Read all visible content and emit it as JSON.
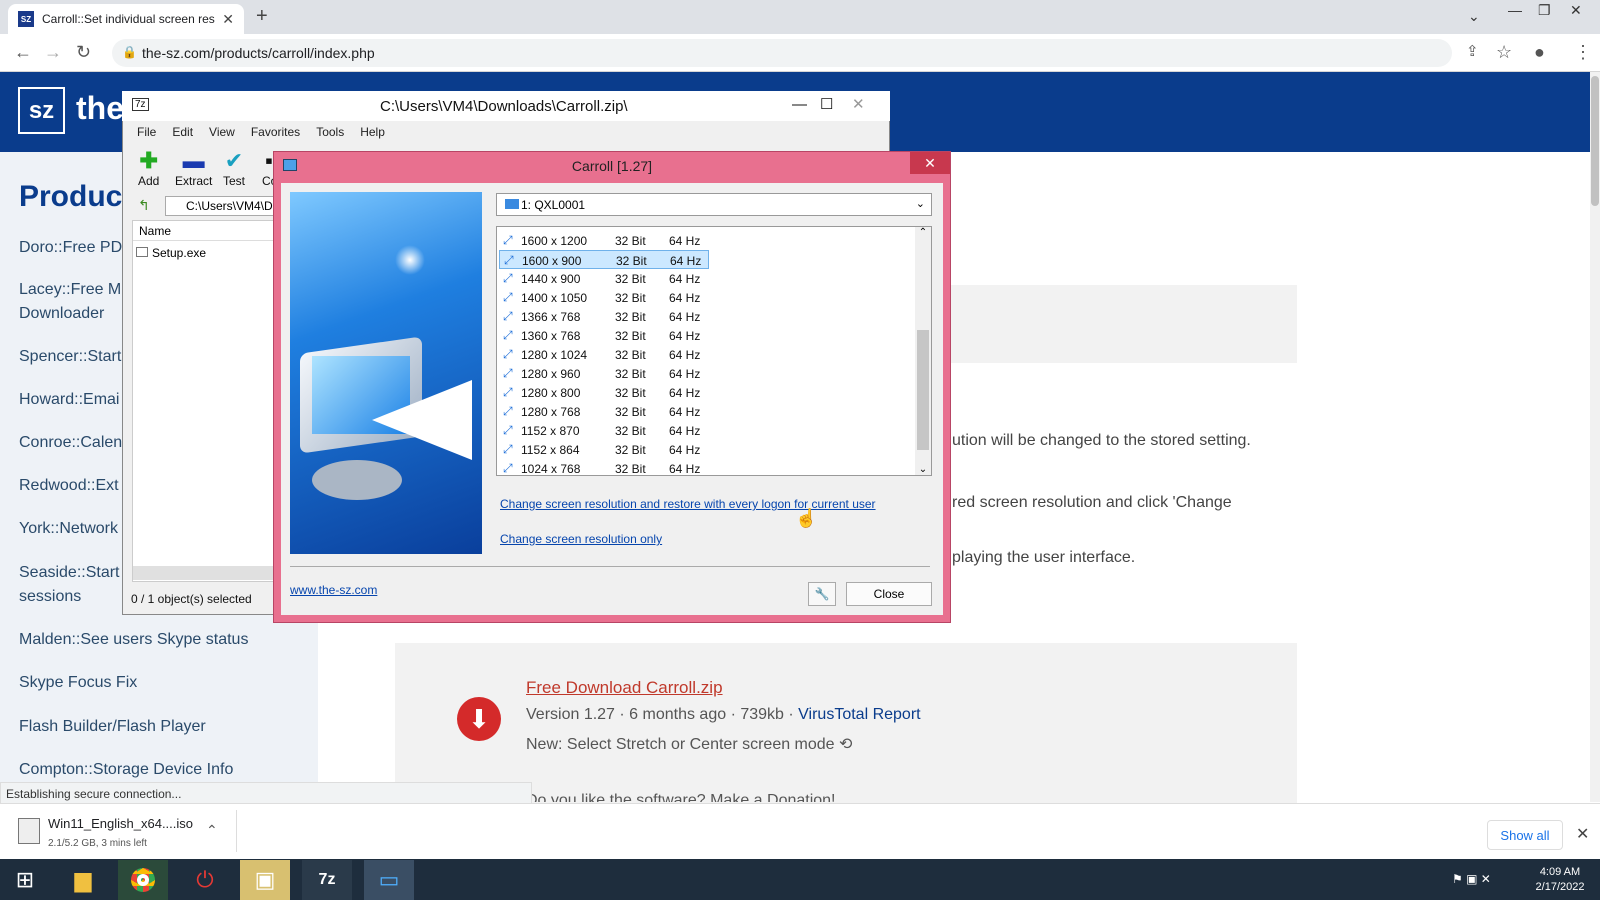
{
  "browser": {
    "tab_title": "Carroll::Set individual screen res…",
    "tab_favicon": "SZ",
    "url": "the-sz.com/products/carroll/index.php",
    "status": "Establishing secure connection..."
  },
  "page": {
    "logo": "sz",
    "logo_text": "the",
    "products_title": "Produc",
    "sidebar": [
      "Doro::Free PDI",
      "Lacey::Free Mu",
      "Downloader",
      "Spencer::Start",
      "Howard::Emai",
      "Conroe::Calen",
      "Redwood::Ext",
      "York::Network",
      "Seaside::Start",
      "sessions",
      "Malden::See users Skype status",
      "Skype Focus Fix",
      "Flash Builder/Flash Player",
      "Compton::Storage Device Info"
    ],
    "text1": "ution will be changed to the stored setting.",
    "text2": "red screen resolution and click 'Change",
    "text3": "playing the user interface.",
    "download_link": "Free Download Carroll.zip",
    "download_meta_prefix": "Version 1.27 · 6 months ago · 739kb · ",
    "download_meta_link": "VirusTotal Report",
    "download_new": "New: Select Stretch or Center screen mode ⟲",
    "donate": "Do you like the software? Make a Donation!"
  },
  "download_bar": {
    "file": "Win11_English_x64....iso",
    "progress": "2.1/5.2 GB, 3 mins left",
    "show_all": "Show all"
  },
  "taskbar": {
    "time": "4:09 AM",
    "date": "2/17/2022"
  },
  "zip": {
    "title": "C:\\Users\\VM4\\Downloads\\Carroll.zip\\",
    "menu": [
      "File",
      "Edit",
      "View",
      "Favorites",
      "Tools",
      "Help"
    ],
    "tools": [
      "Add",
      "Extract",
      "Test",
      "Co"
    ],
    "address": "C:\\Users\\VM4\\D",
    "col_name": "Name",
    "file": "Setup.exe",
    "status": "0 / 1 object(s) selected"
  },
  "carroll": {
    "title": "Carroll [1.27]",
    "display": "1: QXL0001",
    "resolutions": [
      {
        "res": "1600 x 1200",
        "bits": "32 Bit",
        "hz": "64 Hz"
      },
      {
        "res": "1600 x 900",
        "bits": "32 Bit",
        "hz": "64 Hz"
      },
      {
        "res": "1440 x 900",
        "bits": "32 Bit",
        "hz": "64 Hz"
      },
      {
        "res": "1400 x 1050",
        "bits": "32 Bit",
        "hz": "64 Hz"
      },
      {
        "res": "1366 x 768",
        "bits": "32 Bit",
        "hz": "64 Hz"
      },
      {
        "res": "1360 x 768",
        "bits": "32 Bit",
        "hz": "64 Hz"
      },
      {
        "res": "1280 x 1024",
        "bits": "32 Bit",
        "hz": "64 Hz"
      },
      {
        "res": "1280 x 960",
        "bits": "32 Bit",
        "hz": "64 Hz"
      },
      {
        "res": "1280 x 800",
        "bits": "32 Bit",
        "hz": "64 Hz"
      },
      {
        "res": "1280 x 768",
        "bits": "32 Bit",
        "hz": "64 Hz"
      },
      {
        "res": "1152 x 870",
        "bits": "32 Bit",
        "hz": "64 Hz"
      },
      {
        "res": "1152 x 864",
        "bits": "32 Bit",
        "hz": "64 Hz"
      },
      {
        "res": "1024 x 768",
        "bits": "32 Bit",
        "hz": "64 Hz"
      }
    ],
    "selected": "1600 x 900",
    "link_restore": "Change screen resolution and restore with every logon for current user",
    "link_only": "Change screen resolution only",
    "website": "www.the-sz.com",
    "close": "Close"
  }
}
